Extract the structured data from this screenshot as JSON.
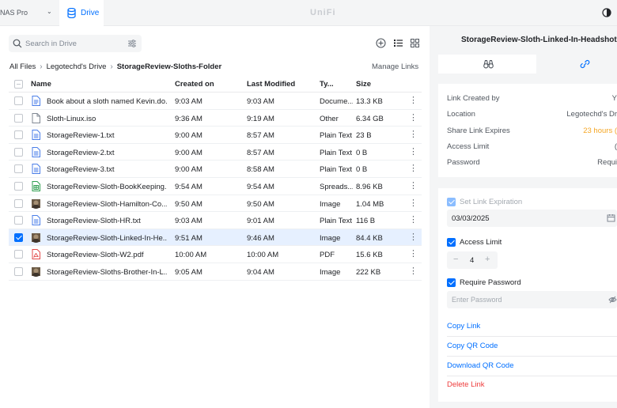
{
  "topbar": {
    "device_name": "NAS Pro",
    "app_tab": "Drive",
    "brand": "UniFi"
  },
  "search": {
    "placeholder": "Search in Drive"
  },
  "breadcrumb": {
    "items": [
      "All Files",
      "Legotechd's Drive",
      "StorageReview-Sloths-Folder"
    ]
  },
  "manage_links_label": "Manage Links",
  "table": {
    "headers": {
      "name": "Name",
      "created": "Created on",
      "modified": "Last Modified",
      "type": "Ty...",
      "size": "Size"
    },
    "rows": [
      {
        "name": "Book about a sloth named Kevin.do...",
        "created": "9:03 AM",
        "modified": "9:03 AM",
        "type": "Docume...",
        "size": "13.3 KB",
        "icon": "doc-icon",
        "selected": false
      },
      {
        "name": "Sloth-Linux.iso",
        "created": "9:36 AM",
        "modified": "9:19 AM",
        "type": "Other",
        "size": "6.34 GB",
        "icon": "file-icon",
        "selected": false
      },
      {
        "name": "StorageReview-1.txt",
        "created": "9:00 AM",
        "modified": "8:57 AM",
        "type": "Plain Text",
        "size": "23 B",
        "icon": "text-file-icon",
        "selected": false
      },
      {
        "name": "StorageReview-2.txt",
        "created": "9:00 AM",
        "modified": "8:57 AM",
        "type": "Plain Text",
        "size": "0 B",
        "icon": "text-file-icon",
        "selected": false
      },
      {
        "name": "StorageReview-3.txt",
        "created": "9:00 AM",
        "modified": "8:58 AM",
        "type": "Plain Text",
        "size": "0 B",
        "icon": "text-file-icon",
        "selected": false
      },
      {
        "name": "StorageReview-Sloth-BookKeeping...",
        "created": "9:54 AM",
        "modified": "9:54 AM",
        "type": "Spreads...",
        "size": "8.96 KB",
        "icon": "spreadsheet-icon",
        "selected": false
      },
      {
        "name": "StorageReview-Sloth-Hamilton-Co...",
        "created": "9:50 AM",
        "modified": "9:50 AM",
        "type": "Image",
        "size": "1.04 MB",
        "icon": "image-thumbnail-icon",
        "selected": false
      },
      {
        "name": "StorageReview-Sloth-HR.txt",
        "created": "9:03 AM",
        "modified": "9:01 AM",
        "type": "Plain Text",
        "size": "116 B",
        "icon": "text-file-icon",
        "selected": false
      },
      {
        "name": "StorageReview-Sloth-Linked-In-He...",
        "created": "9:51 AM",
        "modified": "9:46 AM",
        "type": "Image",
        "size": "84.4 KB",
        "icon": "image-thumbnail-icon",
        "selected": true
      },
      {
        "name": "StorageReview-Sloth-W2.pdf",
        "created": "10:00 AM",
        "modified": "10:00 AM",
        "type": "PDF",
        "size": "15.6 KB",
        "icon": "pdf-icon",
        "selected": false
      },
      {
        "name": "StorageReview-Sloths-Brother-In-L...",
        "created": "9:05 AM",
        "modified": "9:04 AM",
        "type": "Image",
        "size": "222 KB",
        "icon": "image-thumbnail-icon",
        "selected": false
      }
    ]
  },
  "side": {
    "title": "StorageReview-Sloth-Linked-In-Headshot.jpg",
    "info": [
      {
        "key": "Link Created by",
        "value": "Y"
      },
      {
        "key": "Location",
        "value": "Legotechd's Dr"
      },
      {
        "key": "Share Link Expires",
        "value": "23 hours ("
      },
      {
        "key": "Access Limit",
        "value": "("
      },
      {
        "key": "Password",
        "value": "Requi"
      }
    ],
    "set_expiration_label": "Set Link Expiration",
    "expiration_date": "03/03/2025",
    "access_limit_label": "Access Limit",
    "access_limit_value": "4",
    "require_password_label": "Require Password",
    "password_placeholder": "Enter Password",
    "actions": {
      "copy_link": "Copy Link",
      "copy_qr": "Copy QR Code",
      "download_qr": "Download QR Code",
      "delete": "Delete Link"
    }
  },
  "colors": {
    "accent": "#006fff",
    "danger": "#ee3b3b",
    "warning": "#f5a623",
    "selected_row": "#e6f0ff"
  }
}
